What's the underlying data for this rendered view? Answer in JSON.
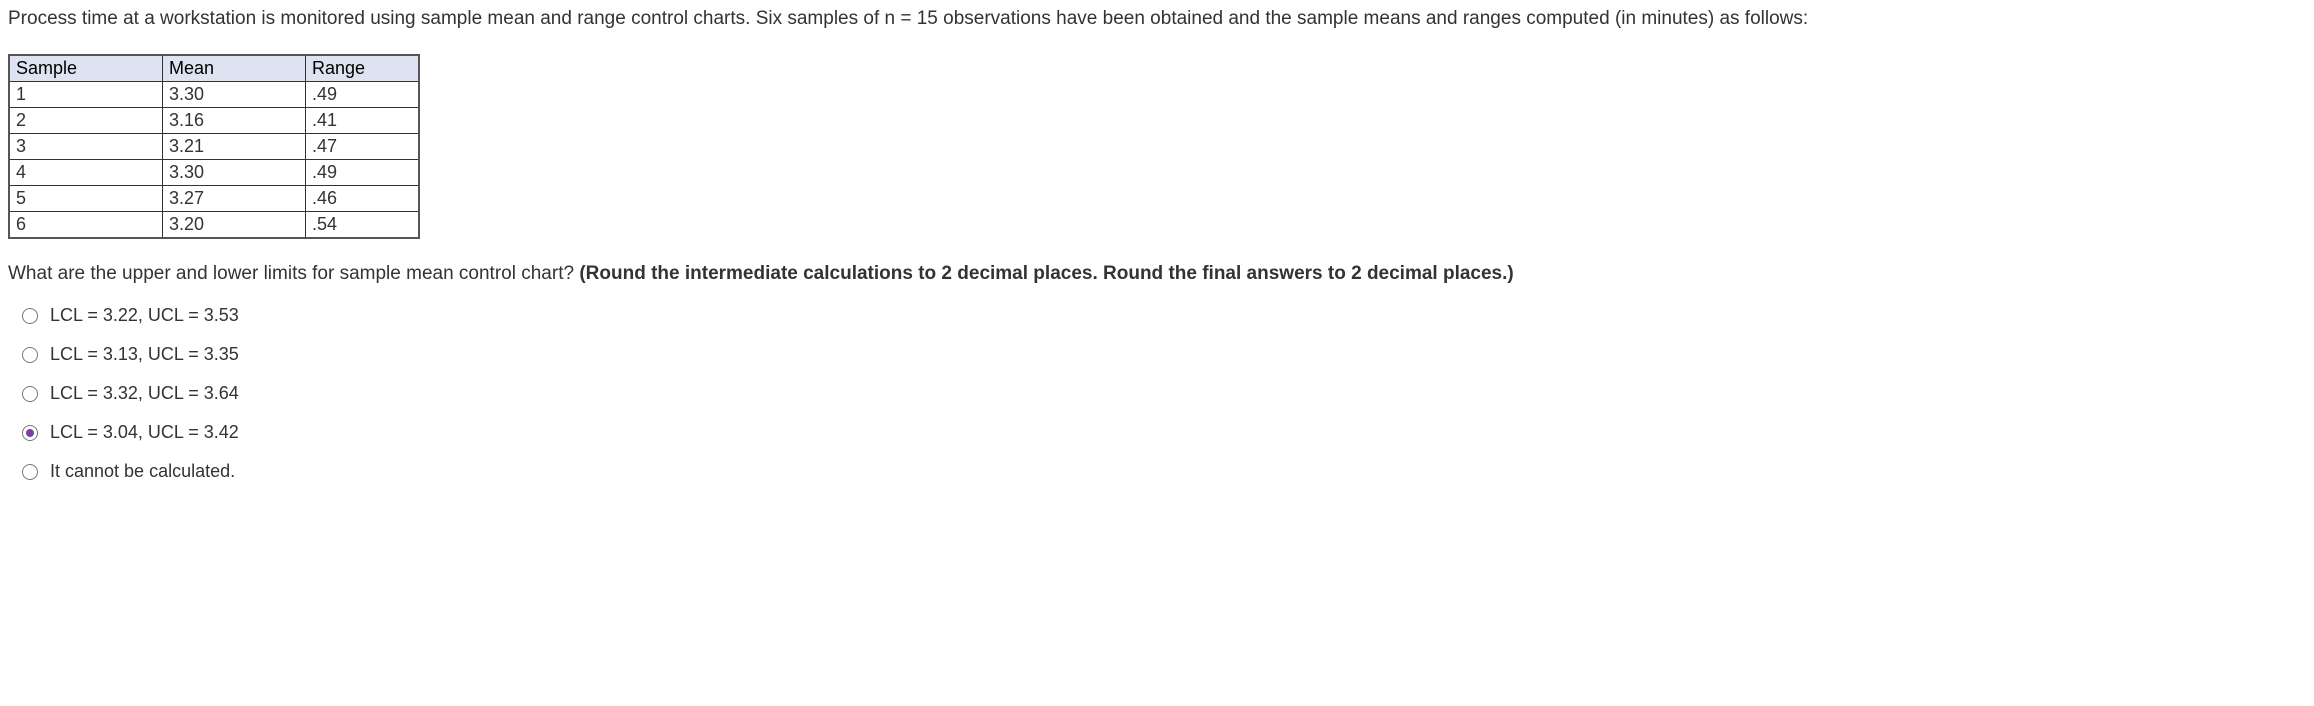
{
  "intro": "Process time at a workstation is monitored using sample mean and range control charts. Six samples of n = 15 observations have been obtained and the sample means and ranges computed (in minutes) as follows:",
  "table": {
    "headers": {
      "sample": "Sample",
      "mean": "Mean",
      "range": "Range"
    },
    "rows": [
      {
        "sample": "1",
        "mean": "3.30",
        "range": ".49"
      },
      {
        "sample": "2",
        "mean": "3.16",
        "range": ".41"
      },
      {
        "sample": "3",
        "mean": "3.21",
        "range": ".47"
      },
      {
        "sample": "4",
        "mean": "3.30",
        "range": ".49"
      },
      {
        "sample": "5",
        "mean": "3.27",
        "range": ".46"
      },
      {
        "sample": "6",
        "mean": "3.20",
        "range": ".54"
      }
    ]
  },
  "question": {
    "text": "What are the upper and lower limits for sample mean control chart? ",
    "bold": "(Round the intermediate calculations to 2 decimal places. Round the final answers to 2 decimal places.)"
  },
  "options": [
    {
      "label": "LCL = 3.22, UCL = 3.53",
      "selected": false
    },
    {
      "label": "LCL = 3.13, UCL = 3.35",
      "selected": false
    },
    {
      "label": "LCL = 3.32, UCL = 3.64",
      "selected": false
    },
    {
      "label": "LCL = 3.04, UCL = 3.42",
      "selected": true
    },
    {
      "label": "It cannot be calculated.",
      "selected": false
    }
  ]
}
